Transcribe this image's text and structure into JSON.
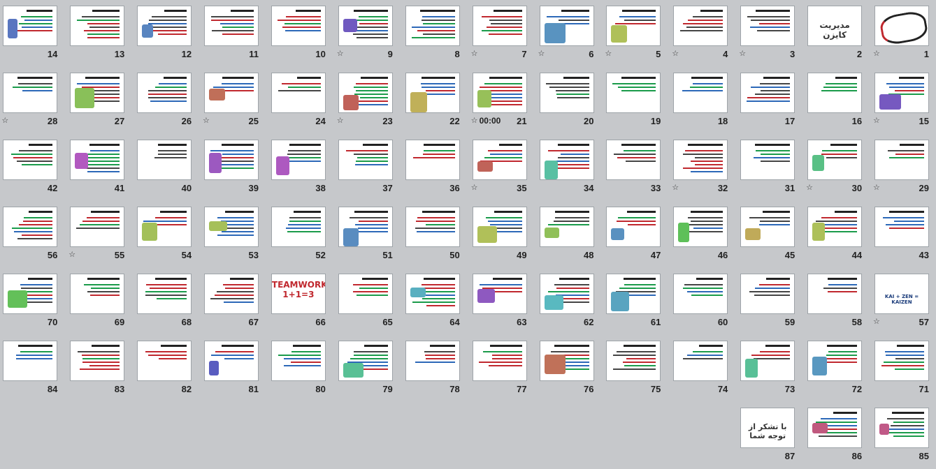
{
  "view": "slide-sorter",
  "slides": [
    {
      "number": "1",
      "star": true
    },
    {
      "number": "2",
      "star": false,
      "thumb_text": "مدیریت کایزن"
    },
    {
      "number": "3",
      "star": true
    },
    {
      "number": "4",
      "star": true
    },
    {
      "number": "5",
      "star": true
    },
    {
      "number": "6",
      "star": true
    },
    {
      "number": "7",
      "star": true
    },
    {
      "number": "8",
      "star": false
    },
    {
      "number": "9",
      "star": true
    },
    {
      "number": "10",
      "star": false
    },
    {
      "number": "11",
      "star": false
    },
    {
      "number": "12",
      "star": false
    },
    {
      "number": "13",
      "star": false
    },
    {
      "number": "14",
      "star": false
    },
    {
      "number": "15",
      "star": true
    },
    {
      "number": "16",
      "star": false
    },
    {
      "number": "17",
      "star": false
    },
    {
      "number": "18",
      "star": false
    },
    {
      "number": "19",
      "star": false
    },
    {
      "number": "20",
      "star": false
    },
    {
      "number": "21",
      "star": true,
      "timer": "00:00"
    },
    {
      "number": "22",
      "star": false
    },
    {
      "number": "23",
      "star": true
    },
    {
      "number": "24",
      "star": false
    },
    {
      "number": "25",
      "star": true
    },
    {
      "number": "26",
      "star": false
    },
    {
      "number": "27",
      "star": false
    },
    {
      "number": "28",
      "star": true
    },
    {
      "number": "29",
      "star": true
    },
    {
      "number": "30",
      "star": true
    },
    {
      "number": "31",
      "star": false
    },
    {
      "number": "32",
      "star": true
    },
    {
      "number": "33",
      "star": false
    },
    {
      "number": "34",
      "star": false
    },
    {
      "number": "35",
      "star": true
    },
    {
      "number": "36",
      "star": false
    },
    {
      "number": "37",
      "star": false
    },
    {
      "number": "38",
      "star": false
    },
    {
      "number": "39",
      "star": false
    },
    {
      "number": "40",
      "star": false
    },
    {
      "number": "41",
      "star": false
    },
    {
      "number": "42",
      "star": false
    },
    {
      "number": "43",
      "star": false
    },
    {
      "number": "44",
      "star": false
    },
    {
      "number": "45",
      "star": false
    },
    {
      "number": "46",
      "star": false
    },
    {
      "number": "47",
      "star": false
    },
    {
      "number": "48",
      "star": false
    },
    {
      "number": "49",
      "star": false
    },
    {
      "number": "50",
      "star": false
    },
    {
      "number": "51",
      "star": false
    },
    {
      "number": "52",
      "star": false
    },
    {
      "number": "53",
      "star": false
    },
    {
      "number": "54",
      "star": false
    },
    {
      "number": "55",
      "star": true
    },
    {
      "number": "56",
      "star": false
    },
    {
      "number": "57",
      "star": true,
      "thumb_text": "KAI + ZEN = KAIZEN"
    },
    {
      "number": "58",
      "star": false
    },
    {
      "number": "59",
      "star": false
    },
    {
      "number": "60",
      "star": false
    },
    {
      "number": "61",
      "star": false
    },
    {
      "number": "62",
      "star": false
    },
    {
      "number": "63",
      "star": false
    },
    {
      "number": "64",
      "star": false
    },
    {
      "number": "65",
      "star": false
    },
    {
      "number": "66",
      "star": false,
      "thumb_text": "TEAMWORK 1+1=3"
    },
    {
      "number": "67",
      "star": false
    },
    {
      "number": "68",
      "star": false
    },
    {
      "number": "69",
      "star": false
    },
    {
      "number": "70",
      "star": false
    },
    {
      "number": "71",
      "star": false
    },
    {
      "number": "72",
      "star": false
    },
    {
      "number": "73",
      "star": false
    },
    {
      "number": "74",
      "star": false
    },
    {
      "number": "75",
      "star": false
    },
    {
      "number": "76",
      "star": false
    },
    {
      "number": "77",
      "star": false
    },
    {
      "number": "78",
      "star": false
    },
    {
      "number": "79",
      "star": false
    },
    {
      "number": "80",
      "star": false
    },
    {
      "number": "81",
      "star": false
    },
    {
      "number": "82",
      "star": false
    },
    {
      "number": "83",
      "star": false
    },
    {
      "number": "84",
      "star": false
    },
    {
      "number": "85",
      "star": false
    },
    {
      "number": "86",
      "star": false
    },
    {
      "number": "87",
      "star": false,
      "thumb_text": "با تشکر از توجه شما"
    }
  ],
  "colors": {
    "background": "#c6c8cb",
    "thumb_bg": "#ffffff",
    "thumb_border": "#9ea3a8",
    "accent_green": "#1a9b4a",
    "accent_red": "#c0282e",
    "accent_blue": "#2c68b8"
  },
  "icons": {
    "star": "☆"
  }
}
